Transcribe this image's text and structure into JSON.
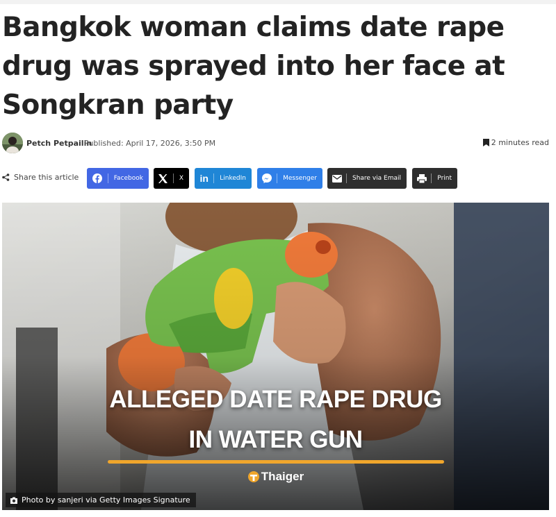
{
  "article": {
    "title": "Bangkok woman claims date rape drug was sprayed into her face at Songkran party",
    "author": "Petch Petpailin",
    "published": "Published: April 17, 2026, 3:50 PM",
    "read_time": "2 minutes read"
  },
  "share": {
    "label": "Share this article",
    "buttons": [
      {
        "label": "Facebook",
        "color": "#4267e4",
        "icon": "facebook-icon"
      },
      {
        "label": "X",
        "color": "#000000",
        "icon": "x-icon"
      },
      {
        "label": "LinkedIn",
        "color": "#1f86d6",
        "icon": "linkedin-icon"
      },
      {
        "label": "Messenger",
        "color": "#2f7fe8",
        "icon": "messenger-icon"
      },
      {
        "label": "Share via Email",
        "color": "#2e2e2e",
        "icon": "email-icon"
      },
      {
        "label": "Print",
        "color": "#2e2e2e",
        "icon": "print-icon"
      }
    ]
  },
  "hero": {
    "headline_line1": "ALLEGED DATE RAPE DRUG",
    "headline_line2": "IN WATER GUN",
    "brand": "Thaiger",
    "caption": "Photo by sanjeri via Getty Images Signature",
    "accent_color": "#f0a62c"
  }
}
